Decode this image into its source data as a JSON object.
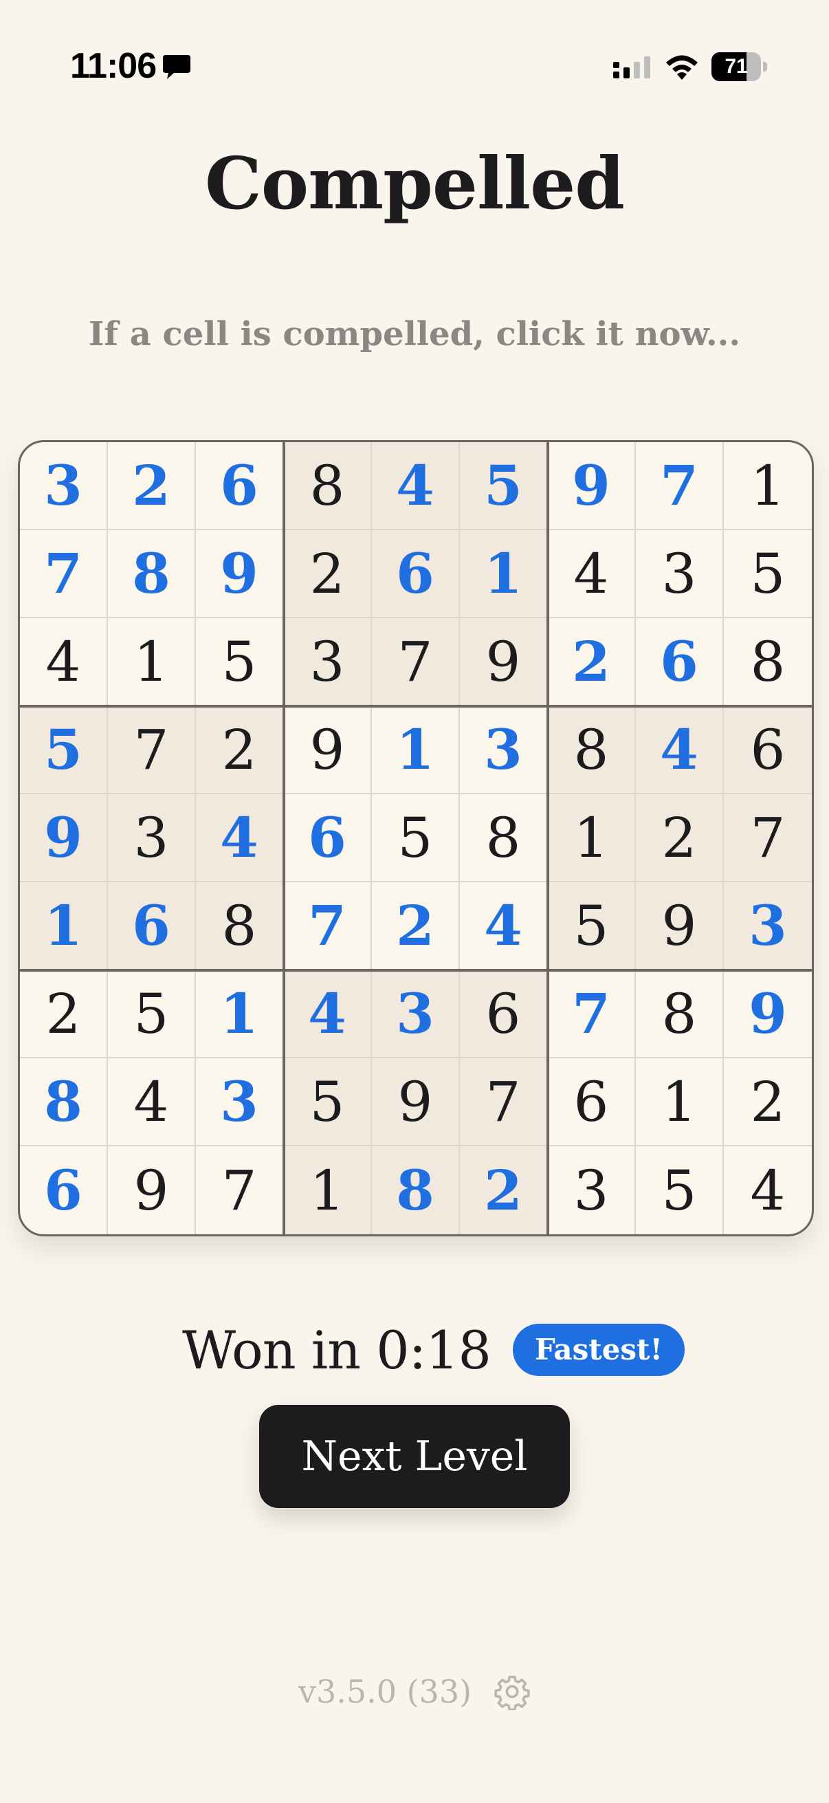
{
  "status_bar": {
    "time": "11:06",
    "battery_level": "71",
    "battery_fraction": 0.71,
    "icons": [
      "message-icon",
      "cellular-signal-icon",
      "wifi-icon",
      "battery-icon"
    ]
  },
  "title": "Compelled",
  "subtitle": "If a cell is compelled, click it now...",
  "board": {
    "cells": [
      [
        "3",
        "2",
        "6",
        "8",
        "4",
        "5",
        "9",
        "7",
        "1"
      ],
      [
        "7",
        "8",
        "9",
        "2",
        "6",
        "1",
        "4",
        "3",
        "5"
      ],
      [
        "4",
        "1",
        "5",
        "3",
        "7",
        "9",
        "2",
        "6",
        "8"
      ],
      [
        "5",
        "7",
        "2",
        "9",
        "1",
        "3",
        "8",
        "4",
        "6"
      ],
      [
        "9",
        "3",
        "4",
        "6",
        "5",
        "8",
        "1",
        "2",
        "7"
      ],
      [
        "1",
        "6",
        "8",
        "7",
        "2",
        "4",
        "5",
        "9",
        "3"
      ],
      [
        "2",
        "5",
        "1",
        "4",
        "3",
        "6",
        "7",
        "8",
        "9"
      ],
      [
        "8",
        "4",
        "3",
        "5",
        "9",
        "7",
        "6",
        "1",
        "2"
      ],
      [
        "6",
        "9",
        "7",
        "1",
        "8",
        "2",
        "3",
        "5",
        "4"
      ]
    ],
    "highlighted": [
      [
        1,
        1,
        1,
        0,
        1,
        1,
        1,
        1,
        0
      ],
      [
        1,
        1,
        1,
        0,
        1,
        1,
        0,
        0,
        0
      ],
      [
        0,
        0,
        0,
        0,
        0,
        0,
        1,
        1,
        0
      ],
      [
        1,
        0,
        0,
        0,
        1,
        1,
        0,
        1,
        0
      ],
      [
        1,
        0,
        1,
        1,
        0,
        0,
        0,
        0,
        0
      ],
      [
        1,
        1,
        0,
        1,
        1,
        1,
        0,
        0,
        1
      ],
      [
        0,
        0,
        1,
        1,
        1,
        0,
        1,
        0,
        1
      ],
      [
        1,
        0,
        1,
        0,
        0,
        0,
        0,
        0,
        0
      ],
      [
        1,
        0,
        0,
        0,
        1,
        1,
        0,
        0,
        0
      ]
    ],
    "colors": {
      "highlight": "#1f6fe0",
      "given": "#1c1c1e",
      "shaded_box": "#f1e9dd",
      "background": "#f9f5ec"
    }
  },
  "result": {
    "text": "Won in 0:18",
    "badge": "Fastest!"
  },
  "next_button_label": "Next Level",
  "footer": {
    "version": "v3.5.0 (33)",
    "settings_icon": "gear-icon"
  }
}
